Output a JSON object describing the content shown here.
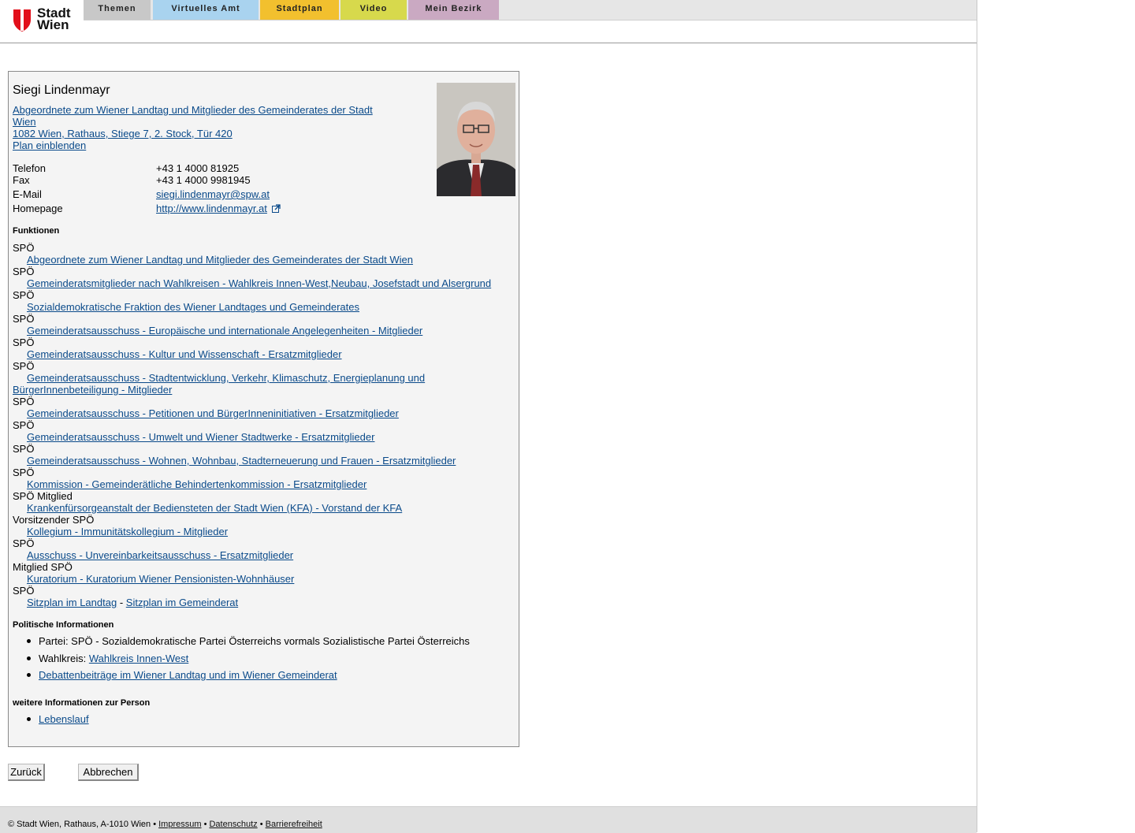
{
  "header": {
    "logo_text_line1": "Stadt",
    "logo_text_line2": "Wien",
    "nav": [
      {
        "label": "Themen",
        "color": "#c8c8c8"
      },
      {
        "label": "Virtuelles Amt",
        "color": "#a9d3ef"
      },
      {
        "label": "Stadtplan",
        "color": "#f2c02e"
      },
      {
        "label": "Video",
        "color": "#d7d94c"
      },
      {
        "label": "Mein Bezirk",
        "color": "#caa9c2"
      }
    ]
  },
  "person": {
    "name": "Siegi Lindenmayr",
    "role_line1": "Abgeordnete zum Wiener Landtag und Mitglieder des Gemeinderates der Stadt",
    "role_line2": "Wien",
    "address": "1082 Wien, Rathaus, Stiege 7, 2. Stock, Tür 420",
    "plan_link": "Plan einblenden",
    "contact": {
      "phone_label": "Telefon",
      "phone": "+43 1 4000 81925",
      "fax_label": "Fax",
      "fax": "+43 1 4000 9981945",
      "email_label": "E-Mail",
      "email": "siegi.lindenmayr@spw.at",
      "homepage_label": "Homepage",
      "homepage": "http://www.lindenmayr.at"
    }
  },
  "functions": {
    "heading": "Funktionen",
    "items": [
      {
        "role": "SPÖ",
        "link": "Abgeordnete zum Wiener Landtag und Mitglieder des Gemeinderates der Stadt Wien"
      },
      {
        "role": "SPÖ",
        "link": "Gemeinderatsmitglieder nach Wahlkreisen - Wahlkreis Innen-West,Neubau, Josefstadt und Alsergrund"
      },
      {
        "role": "SPÖ",
        "link": "Sozialdemokratische Fraktion des Wiener Landtages und Gemeinderates"
      },
      {
        "role": "SPÖ",
        "link": "Gemeinderatsausschuss - Europäische und internationale Angelegenheiten - Mitglieder"
      },
      {
        "role": "SPÖ",
        "link": "Gemeinderatsausschuss - Kultur und Wissenschaft - Ersatzmitglieder"
      },
      {
        "role": "SPÖ",
        "link_line1": "Gemeinderatsausschuss - Stadtentwicklung, Verkehr, Klimaschutz, Energieplanung und",
        "link_line2": "BürgerInnenbeteiligung - Mitglieder"
      },
      {
        "role": "SPÖ",
        "link": "Gemeinderatsausschuss - Petitionen und BürgerInneninitiativen - Ersatzmitglieder"
      },
      {
        "role": "SPÖ",
        "link": "Gemeinderatsausschuss - Umwelt und Wiener Stadtwerke - Ersatzmitglieder"
      },
      {
        "role": "SPÖ",
        "link": "Gemeinderatsausschuss - Wohnen, Wohnbau, Stadterneuerung und Frauen - Ersatzmitglieder"
      },
      {
        "role": "SPÖ",
        "link": "Kommission - Gemeinderätliche Behindertenkommission - Ersatzmitglieder"
      },
      {
        "role": "SPÖ Mitglied",
        "link": "Krankenfürsorgeanstalt der Bediensteten der Stadt Wien (KFA) - Vorstand der KFA"
      },
      {
        "role": "Vorsitzender SPÖ",
        "link": "Kollegium - Immunitätskollegium - Mitglieder"
      },
      {
        "role": "SPÖ",
        "link": "Ausschuss - Unvereinbarkeitsausschuss - Ersatzmitglieder"
      },
      {
        "role": "Mitglied SPÖ",
        "link": "Kuratorium - Kuratorium Wiener Pensionisten-Wohnhäuser"
      },
      {
        "role": "SPÖ",
        "link_a": "Sitzplan im Landtag",
        "separator": "-",
        "link_b": "Sitzplan im Gemeinderat"
      }
    ]
  },
  "political": {
    "heading": "Politische Informationen",
    "party": "Partei: SPÖ - Sozialdemokratische Partei Österreichs vormals Sozialistische Partei Österreichs",
    "district_label": "Wahlkreis:",
    "district_link": "Wahlkreis Innen-West",
    "debates_link": "Debattenbeiträge im Wiener Landtag und im Wiener Gemeinderat"
  },
  "more": {
    "heading": "weitere Informationen zur Person",
    "cv_link": "Lebenslauf"
  },
  "buttons": {
    "back": "Zurück",
    "cancel": "Abbrechen"
  },
  "footer": {
    "copyright": "© Stadt Wien, Rathaus, A-1010 Wien",
    "imprint": "Impressum",
    "privacy": "Datenschutz",
    "accessibility": "Barrierefreiheit"
  }
}
